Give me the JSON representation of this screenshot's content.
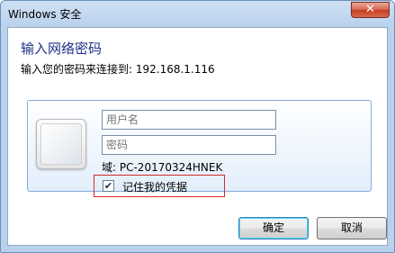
{
  "window": {
    "title": "Windows 安全",
    "close_glyph": "✕"
  },
  "dialog": {
    "heading": "输入网络密码",
    "subheading": "输入您的密码来连接到: 192.168.1.116"
  },
  "credentials": {
    "username_placeholder": "用户名",
    "password_placeholder": "密码",
    "domain_label": "域: PC-20170324HNEK",
    "remember_label": "记住我的凭据",
    "remember_checked": true,
    "check_glyph": "✔"
  },
  "buttons": {
    "ok_label": "确定",
    "cancel_label": "取消"
  },
  "colors": {
    "heading": "#1e3287",
    "highlight_border": "#d22b2b",
    "close_button": "#c43b21"
  }
}
